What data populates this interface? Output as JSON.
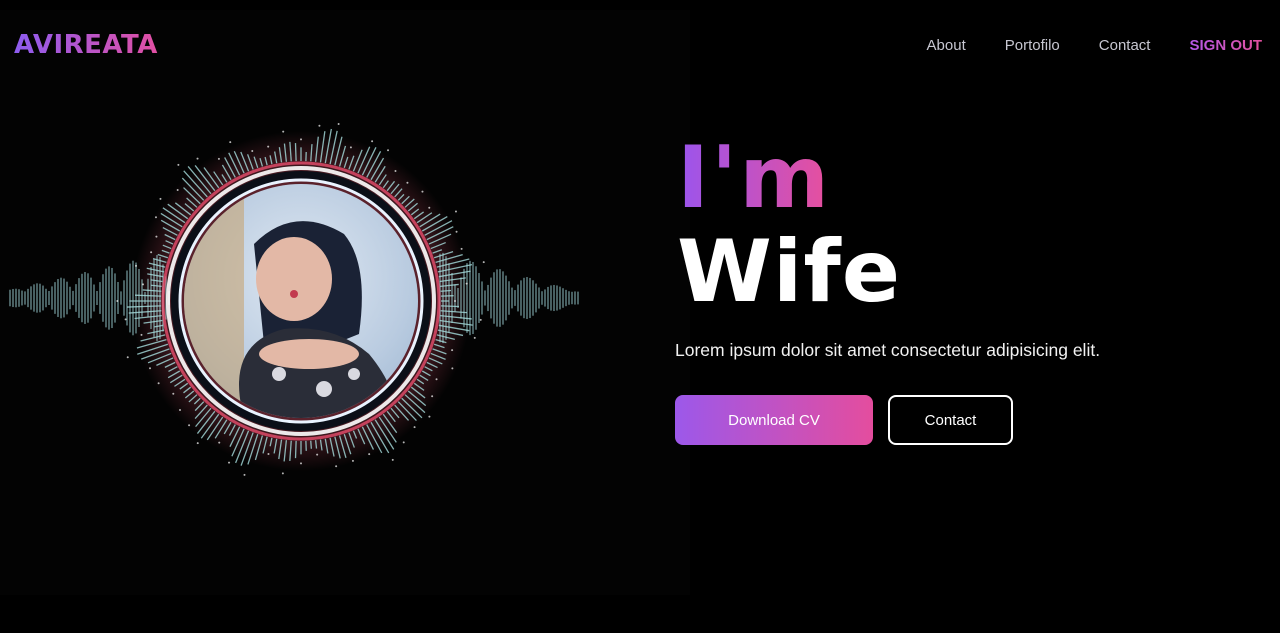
{
  "header": {
    "logo": "AVIREATA",
    "nav": [
      {
        "label": "About"
      },
      {
        "label": "Portofilo"
      },
      {
        "label": "Contact"
      }
    ],
    "sign_out": "SIGN OUT"
  },
  "hero": {
    "intro": "I'm",
    "name": "Wife",
    "description": "Lorem ipsum dolor sit amet consectetur adipisicing elit.",
    "primary_button": "Download CV",
    "secondary_button": "Contact"
  },
  "colors": {
    "gradient_start": "#9a55ee",
    "gradient_end": "#e84f9c",
    "background": "#000000"
  }
}
